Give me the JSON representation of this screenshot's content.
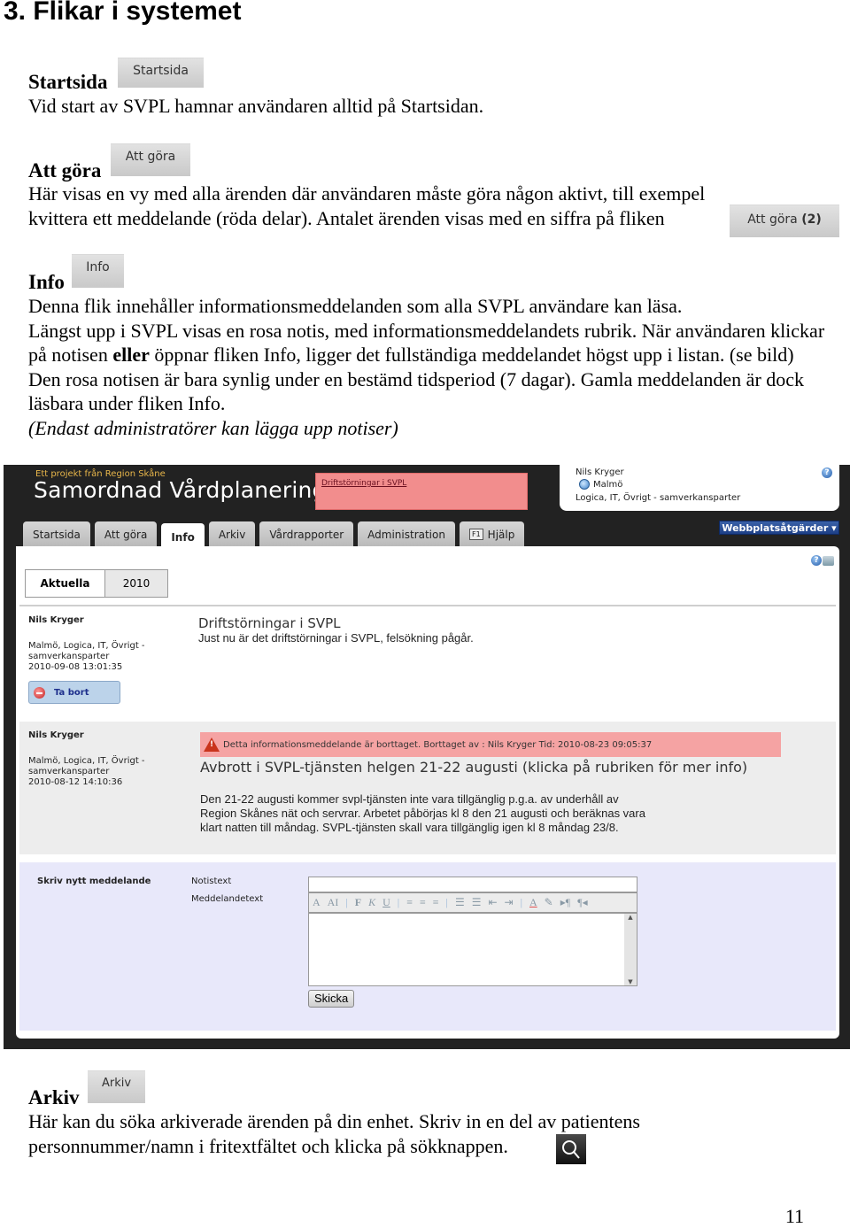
{
  "document": {
    "heading": "3. Flikar i systemet",
    "page_number": "11",
    "sections": {
      "startsida": {
        "title": "Startsida",
        "tab_image_label": "Startsida",
        "text": "Vid start av SVPL hamnar användaren alltid på Startsidan."
      },
      "att_gora": {
        "title": "Att göra",
        "tab_image_label": "Att göra",
        "text_line1": "Här visas en vy med alla ärenden där användaren måste göra någon aktivt, till exempel",
        "text_line2": "kvittera ett meddelande (röda delar). Antalet ärenden visas med en siffra på fliken",
        "count_tab_label": "Att göra",
        "count_tab_count": "(2)"
      },
      "info": {
        "title": "Info",
        "tab_image_label": "Info",
        "p1": "Denna flik innehåller informationsmeddelanden som alla SVPL användare kan läsa.",
        "p2_before_bold": "Längst upp i SVPL visas en rosa notis, med informationsmeddelandets rubrik. När användaren klickar på notisen ",
        "p2_bold": "eller",
        "p2_after_bold": " öppnar fliken Info, ligger det fullständiga meddelandet högst upp i listan. (se bild)",
        "p3": "Den rosa notisen är bara synlig under en bestämd tidsperiod (7 dagar). Gamla meddelanden är dock läsbara under fliken Info.",
        "p4_italic": "(Endast administratörer kan lägga upp notiser)"
      },
      "arkiv": {
        "title": "Arkiv",
        "tab_image_label": "Arkiv",
        "text_line1": "Här kan du söka arkiverade ärenden på din enhet. Skriv in en del av patientens",
        "text_line2": "personnummer/namn i fritextfältet och klicka på sökknappen."
      }
    }
  },
  "screenshot": {
    "project_label": "Ett projekt från Region Skåne",
    "brand": "Samordnad Vårdplanering",
    "notice_link": "Driftstörningar i SVPL",
    "user": {
      "name": "Nils Kryger",
      "location": "Malmö",
      "org": "Logica, IT, Övrigt - samverkansparter"
    },
    "tabs": [
      {
        "label": "Startsida",
        "active": false
      },
      {
        "label": "Att göra",
        "active": false
      },
      {
        "label": "Info",
        "active": true
      },
      {
        "label": "Arkiv",
        "active": false
      },
      {
        "label": "Vårdrapporter",
        "active": false
      },
      {
        "label": "Administration",
        "active": false
      },
      {
        "label": "Hjälp",
        "active": false,
        "key": "F1"
      }
    ],
    "site_actions": "Webbplatsåtgärder ▾",
    "subtabs": [
      {
        "label": "Aktuella",
        "active": true
      },
      {
        "label": "2010",
        "active": false
      }
    ],
    "messages": [
      {
        "author": "Nils Kryger",
        "meta": "Malmö, Logica, IT, Övrigt - samverkansparter",
        "timestamp": "2010-09-08 13:01:35",
        "title": "Driftstörningar i SVPL",
        "body": "Just nu är det driftstörningar i SVPL, felsökning pågår.",
        "delete_label": "Ta bort"
      },
      {
        "author": "Nils Kryger",
        "meta": "Malmö, Logica, IT, Övrigt - samverkansparter",
        "timestamp": "2010-08-12 14:10:36",
        "deleted_notice": "Detta informationsmeddelande är borttaget. Borttaget av : Nils Kryger Tid: 2010-08-23 09:05:37",
        "title": "Avbrott i SVPL-tjänsten helgen 21-22 augusti (klicka på rubriken för mer info)",
        "body": "Den 21-22 augusti kommer svpl-tjänsten inte vara tillgänglig p.g.a. av underhåll av Region Skånes nät och servrar. Arbetet påbörjas kl 8 den 21 augusti och beräknas vara klart natten till måndag. SVPL-tjänsten skall vara tillgänglig igen kl 8 måndag 23/8."
      }
    ],
    "form": {
      "heading": "Skriv nytt meddelande",
      "notis_label": "Notistext",
      "notis_value": "",
      "message_label": "Meddelandetext",
      "message_value": "",
      "submit_label": "Skicka"
    }
  },
  "colors": {
    "notice_pink": "#f28d8d",
    "deleted_pink": "#f5a3a3",
    "dark_frame": "#222222",
    "site_actions_blue": "#2a4f98",
    "form_bg": "#e8e8fa"
  }
}
